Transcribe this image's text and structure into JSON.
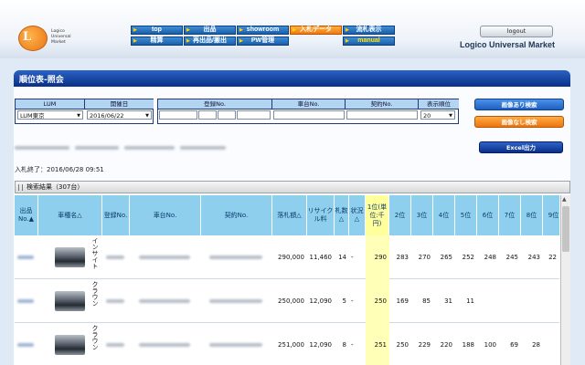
{
  "header": {
    "logo_letter": "L",
    "logo_text": [
      "Logico",
      "Universal",
      "Market"
    ],
    "nav": [
      {
        "label": "top",
        "state": "normal"
      },
      {
        "label": "出品",
        "state": "normal"
      },
      {
        "label": "showroom",
        "state": "normal"
      },
      {
        "label": "入札データ",
        "state": "active"
      },
      {
        "label": "流札表示",
        "state": "normal"
      },
      {
        "label": "精算",
        "state": "normal"
      },
      {
        "label": "再出品/搬出",
        "state": "normal"
      },
      {
        "label": "PW管理",
        "state": "normal"
      },
      {
        "label": "manual",
        "state": "highlight"
      }
    ],
    "logout_label": "logout",
    "company": "Logico Universal Market"
  },
  "page": {
    "title": "順位表-照会"
  },
  "filters": {
    "lum_label": "LUM",
    "lum_value": "LUM東京",
    "date_label": "開催日",
    "date_value": "2016/06/22",
    "reg_label": "登録No.",
    "chassis_label": "車台No.",
    "contract_label": "契約No.",
    "rank_label": "表示順位",
    "rank_value": "20"
  },
  "buttons": {
    "search_with_image": "画像あり検索",
    "search_without_image": "画像なし検索",
    "excel_output": "Excel出力"
  },
  "status_text": "入札終了：2016/06/28 09:51",
  "results_label": "検索結果（307台）",
  "table": {
    "headers": [
      "出品No.▲",
      "車種名△",
      "登録No.",
      "車台No.",
      "契約No.",
      "落札額△",
      "リサイクル料",
      "札数△",
      "状況△",
      "1位(単位:千円)",
      "2位",
      "3位",
      "4位",
      "5位",
      "6位",
      "7位",
      "8位",
      "9位"
    ],
    "rows": [
      {
        "model": "インサイト",
        "price": "290,000",
        "recycle": "11,460",
        "bids": "14",
        "state": "-",
        "ranks": [
          "290",
          "283",
          "270",
          "265",
          "252",
          "248",
          "245",
          "243",
          "22"
        ]
      },
      {
        "model": "クラウン",
        "price": "250,000",
        "recycle": "12,090",
        "bids": "5",
        "state": "-",
        "ranks": [
          "250",
          "169",
          "85",
          "31",
          "11",
          "",
          "",
          "",
          ""
        ]
      },
      {
        "model": "クラウン",
        "price": "251,000",
        "recycle": "12,090",
        "bids": "8",
        "state": "-",
        "ranks": [
          "251",
          "250",
          "229",
          "220",
          "188",
          "100",
          "69",
          "28",
          ""
        ]
      }
    ]
  },
  "colors": {
    "header_bar": "#0a2f89",
    "nav_active": "#f07a10",
    "table_header": "#8fcfee",
    "first_rank": "#ffff9c"
  }
}
